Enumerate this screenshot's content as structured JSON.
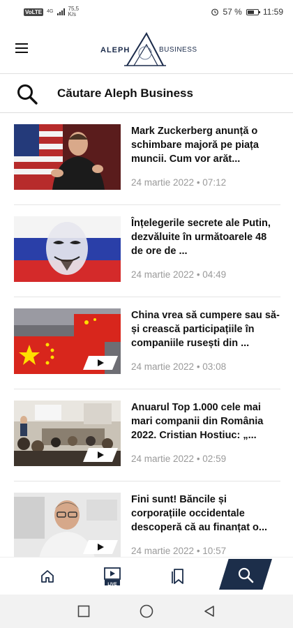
{
  "status_bar": {
    "network_badge": "VoLTE",
    "signal_label": "4G",
    "speed_value": "75,5",
    "speed_unit": "K/s",
    "battery_percent": "57 %",
    "battery_level": 0.57,
    "time": "11:59",
    "icons": [
      "alarm-icon",
      "battery-icon",
      "signal-icon"
    ]
  },
  "header": {
    "logo_left": "ALEPH",
    "logo_right": "BUSINESS",
    "menu_icon": "hamburger-menu-icon"
  },
  "search": {
    "title": "Căutare Aleph Business",
    "icon": "search-icon"
  },
  "articles": [
    {
      "title": "Mark Zuckerberg anunță o schimbare majoră pe piața muncii. Cum vor arăt...",
      "date": "24 martie 2022",
      "time": "07:12",
      "has_video": false,
      "thumb": "person-speaking-flag-background"
    },
    {
      "title": "Înțelegerile secrete ale Putin, dezvăluite în următoarele 48 de ore de ...",
      "date": "24 martie 2022",
      "time": "04:49",
      "has_video": false,
      "thumb": "mask-on-russian-flag"
    },
    {
      "title": "China vrea să cumpere sau să-și crească participațiile în companiile rusești din ...",
      "date": "24 martie 2022",
      "time": "03:08",
      "has_video": true,
      "thumb": "chinese-flag-containers"
    },
    {
      "title": "Anuarul Top 1.000 cele mai mari companii din România 2022. Cristian Hostiuc: „...",
      "date": "24 martie 2022",
      "time": "02:59",
      "has_video": true,
      "thumb": "conference-audience"
    },
    {
      "title": "Fini sunt! Băncile și corporațiile occidentale descoperă că au finanțat o...",
      "date": "24 martie 2022",
      "time": "10:57",
      "has_video": true,
      "thumb": "man-with-glasses-portrait"
    }
  ],
  "tab_bar": {
    "tabs": [
      {
        "name": "home-icon",
        "active": false
      },
      {
        "name": "live-video-icon",
        "active": false,
        "badge": "LIVE"
      },
      {
        "name": "bookmarks-icon",
        "active": false
      },
      {
        "name": "search-icon",
        "active": true
      }
    ],
    "active_color": "#1c2e4a"
  },
  "system_nav": {
    "buttons": [
      "recent-apps-icon",
      "home-circle-icon",
      "back-triangle-icon"
    ]
  },
  "colors": {
    "text": "#111111",
    "meta": "#9a9a9a",
    "accent": "#1c2e4a"
  }
}
